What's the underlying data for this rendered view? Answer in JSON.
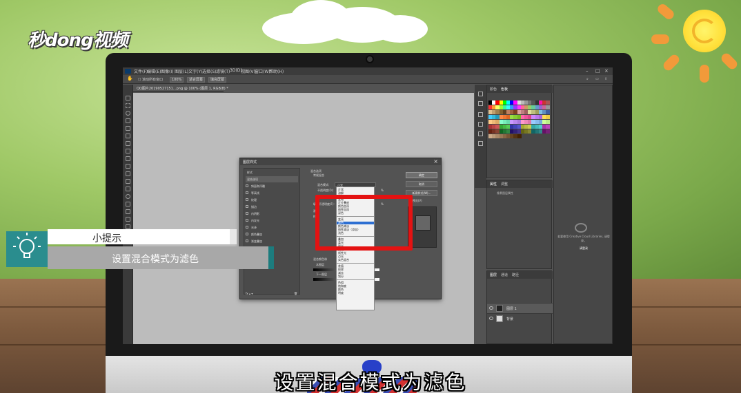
{
  "logo": {
    "text": "秒dong视频"
  },
  "menubar": {
    "items": [
      "文件(F)",
      "编辑(E)",
      "图像(I)",
      "图层(L)",
      "文字(Y)",
      "选择(S)",
      "滤镜(T)",
      "3D(D)",
      "视图(V)",
      "窗口(W)",
      "帮助(H)"
    ]
  },
  "optbar": {
    "checkbox_label": "滚动所有窗口",
    "zoom_value": "100%",
    "fit_screen": "适合屏幕",
    "fill_screen": "填充屏幕"
  },
  "document": {
    "tab_title": "QQ图片20190527151...png @ 100% (图层 1, RGB/8) *"
  },
  "panels": {
    "swatch_tabs": [
      "颜色",
      "色板"
    ],
    "props_tabs": [
      "属性",
      "调整"
    ],
    "props_label": "像素图层属性",
    "layers_tabs": [
      "图层",
      "通道",
      "路径"
    ],
    "layers": [
      {
        "name": "图层 1",
        "active": true
      },
      {
        "name": "背景",
        "active": false
      }
    ],
    "library_text": "若要使用 Creative Cloud Libraries, 请登录。",
    "library_link": "请登录"
  },
  "dialog": {
    "title": "图层样式",
    "left_header": "样式",
    "styles": [
      {
        "label": "混合选项",
        "checked": false,
        "active": true
      },
      {
        "label": "斜面和浮雕",
        "checked": false
      },
      {
        "label": "等高线",
        "checked": false
      },
      {
        "label": "纹理",
        "checked": false
      },
      {
        "label": "描边",
        "checked": false
      },
      {
        "label": "内阴影",
        "checked": false
      },
      {
        "label": "内发光",
        "checked": false
      },
      {
        "label": "光泽",
        "checked": false
      },
      {
        "label": "颜色叠加",
        "checked": false
      },
      {
        "label": "渐变叠加",
        "checked": false
      },
      {
        "label": "图案叠加",
        "checked": false
      },
      {
        "label": "外发光",
        "checked": false
      },
      {
        "label": "投影",
        "checked": false
      }
    ],
    "section_title": "混合选项",
    "section_sub": "常规混合",
    "blend_mode_label": "混合模式:",
    "blend_mode_value": "正常",
    "opacity_label": "不透明度(O):",
    "fill_opacity_label": "填充不透明度(F):",
    "channels_label": "通道",
    "knockout_label": "挖空",
    "blend_if_label": "混合颜色带",
    "this_layer_label": "本图层",
    "under_layer_label": "下一图层",
    "percent": "%",
    "buttons": {
      "ok": "确定",
      "cancel": "取消",
      "new_style": "新建样式(W)...",
      "preview": "预览(V)"
    },
    "blend_menu": [
      [
        "正常",
        "溶解"
      ],
      [
        "变暗",
        "正片叠底",
        "颜色加深",
        "线性加深",
        "深色"
      ],
      [
        "变亮",
        "滤色",
        "颜色减淡",
        "线性减淡（添加）",
        "浅色"
      ],
      [
        "叠加",
        "柔光",
        "强光",
        "亮光",
        "线性光",
        "点光",
        "实色混合"
      ],
      [
        "差值",
        "排除",
        "减去",
        "划分"
      ],
      [
        "色相",
        "饱和度",
        "颜色",
        "明度"
      ]
    ],
    "highlighted_mode": "滤色"
  },
  "tip": {
    "title": "小提示",
    "body": "设置混合模式为滤色"
  },
  "subtitle": "设置混合模式为滤色",
  "colors": {
    "accent_teal": "#2a8d8e",
    "highlight_red": "#e41212",
    "ps_dark": "#3c3c3c",
    "selection_blue": "#2d6fd2"
  }
}
